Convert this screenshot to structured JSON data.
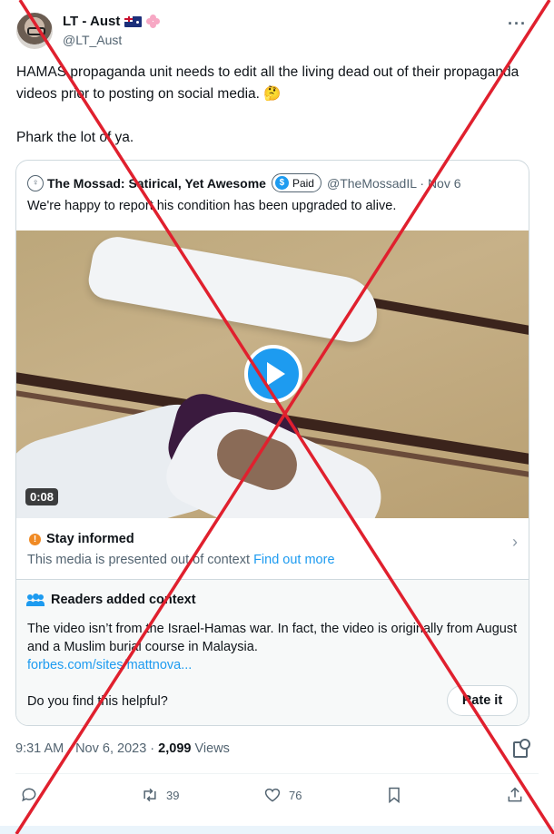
{
  "tweet": {
    "display_name": "LT - Aust",
    "handle": "@LT_Aust",
    "more_icon": "more-icon",
    "text_line1": "HAMAS propaganda unit needs to edit all the living dead out of their propaganda videos prior to posting on social media. 🤔",
    "text_line2": "Phark the lot of ya.",
    "time": "9:31 AM · Nov 6, 2023 ·",
    "views_count": "2,099",
    "views_label": "Views"
  },
  "quote": {
    "name": "The Mossad: Satirical, Yet Awesome",
    "paid_label": "Paid",
    "handle_date": "@TheMossadIL · Nov 6",
    "text": "We're happy to report his condition has been upgraded to alive.",
    "video_duration": "0:08"
  },
  "stay_informed": {
    "title": "Stay informed",
    "text": "This media is presented out of context",
    "link": "Find out more"
  },
  "readers_context": {
    "title": "Readers added context",
    "body": "The video isn’t from the Israel-Hamas war. In fact, the video is originally from August and  a Muslim burial course in Malaysia.",
    "link": "forbes.com/sites/mattnova...",
    "question": "Do you find this helpful?",
    "rate_label": "Rate it"
  },
  "actions": {
    "reply": "",
    "retweets": "39",
    "likes": "76"
  },
  "colors": {
    "accent": "#1d9bf0",
    "overlay_cross": "#e0202e",
    "warning": "#f08a24"
  }
}
